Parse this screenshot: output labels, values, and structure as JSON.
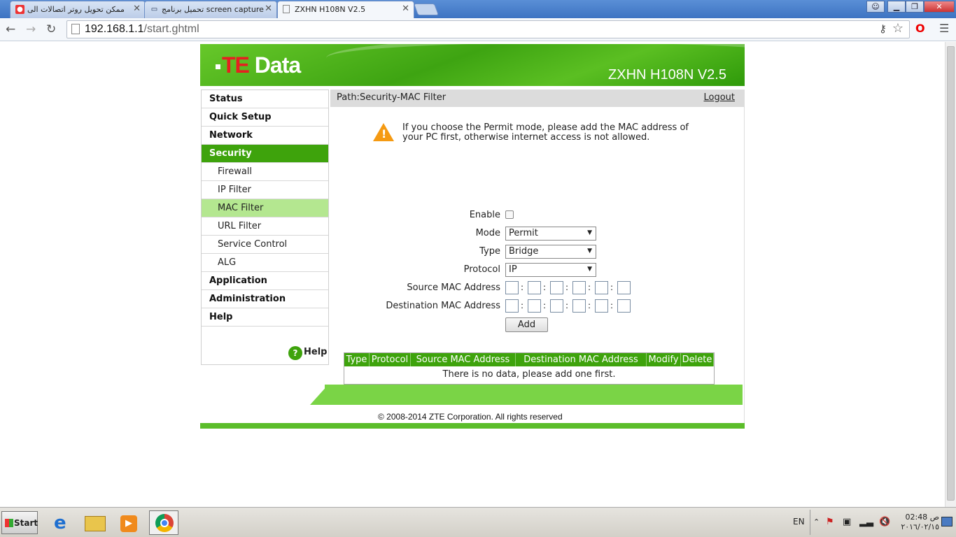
{
  "browser": {
    "tabs": [
      {
        "title": "ممكن تحويل روتر اتصالات الى",
        "active": false
      },
      {
        "title": "تحميل برنامج screen capture",
        "active": false
      },
      {
        "title": "ZXHN H108N V2.5",
        "active": true
      }
    ],
    "url_host": "192.168.1.1",
    "url_path": "/start.ghtml"
  },
  "router": {
    "logo": {
      "prefix": "TE",
      "suffix": "Data"
    },
    "model": "ZXHN H108N V2.5",
    "path": "Path:Security-MAC Filter",
    "logout": "Logout",
    "menu": [
      {
        "label": "Status",
        "type": "top"
      },
      {
        "label": "Quick Setup",
        "type": "top"
      },
      {
        "label": "Network",
        "type": "top"
      },
      {
        "label": "Security",
        "type": "top",
        "active": true
      },
      {
        "label": "Firewall",
        "type": "sub"
      },
      {
        "label": "IP Filter",
        "type": "sub"
      },
      {
        "label": "MAC Filter",
        "type": "sub",
        "active": true
      },
      {
        "label": "URL Filter",
        "type": "sub"
      },
      {
        "label": "Service Control",
        "type": "sub"
      },
      {
        "label": "ALG",
        "type": "sub"
      },
      {
        "label": "Application",
        "type": "top"
      },
      {
        "label": "Administration",
        "type": "top"
      },
      {
        "label": "Help",
        "type": "top"
      }
    ],
    "sidebar_help": "Help",
    "warning_line1": "If you choose the Permit mode, please add the MAC address of",
    "warning_line2": "your PC first, otherwise internet access is not allowed.",
    "form": {
      "enable_label": "Enable",
      "mode_label": "Mode",
      "mode_value": "Permit",
      "type_label": "Type",
      "type_value": "Bridge",
      "protocol_label": "Protocol",
      "protocol_value": "IP",
      "source_mac_label": "Source MAC Address",
      "dest_mac_label": "Destination MAC Address",
      "add_button": "Add"
    },
    "table": {
      "headers": [
        "Type",
        "Protocol",
        "Source MAC Address",
        "Destination MAC Address",
        "Modify",
        "Delete"
      ],
      "empty_message": "There is no data, please add one first."
    },
    "copyright": "© 2008-2014 ZTE Corporation. All rights reserved"
  },
  "taskbar": {
    "start_label": "Start",
    "language": "EN",
    "time_period": "ص",
    "time": "02:48",
    "date": "٢٠١٦/٠٢/١٥"
  }
}
